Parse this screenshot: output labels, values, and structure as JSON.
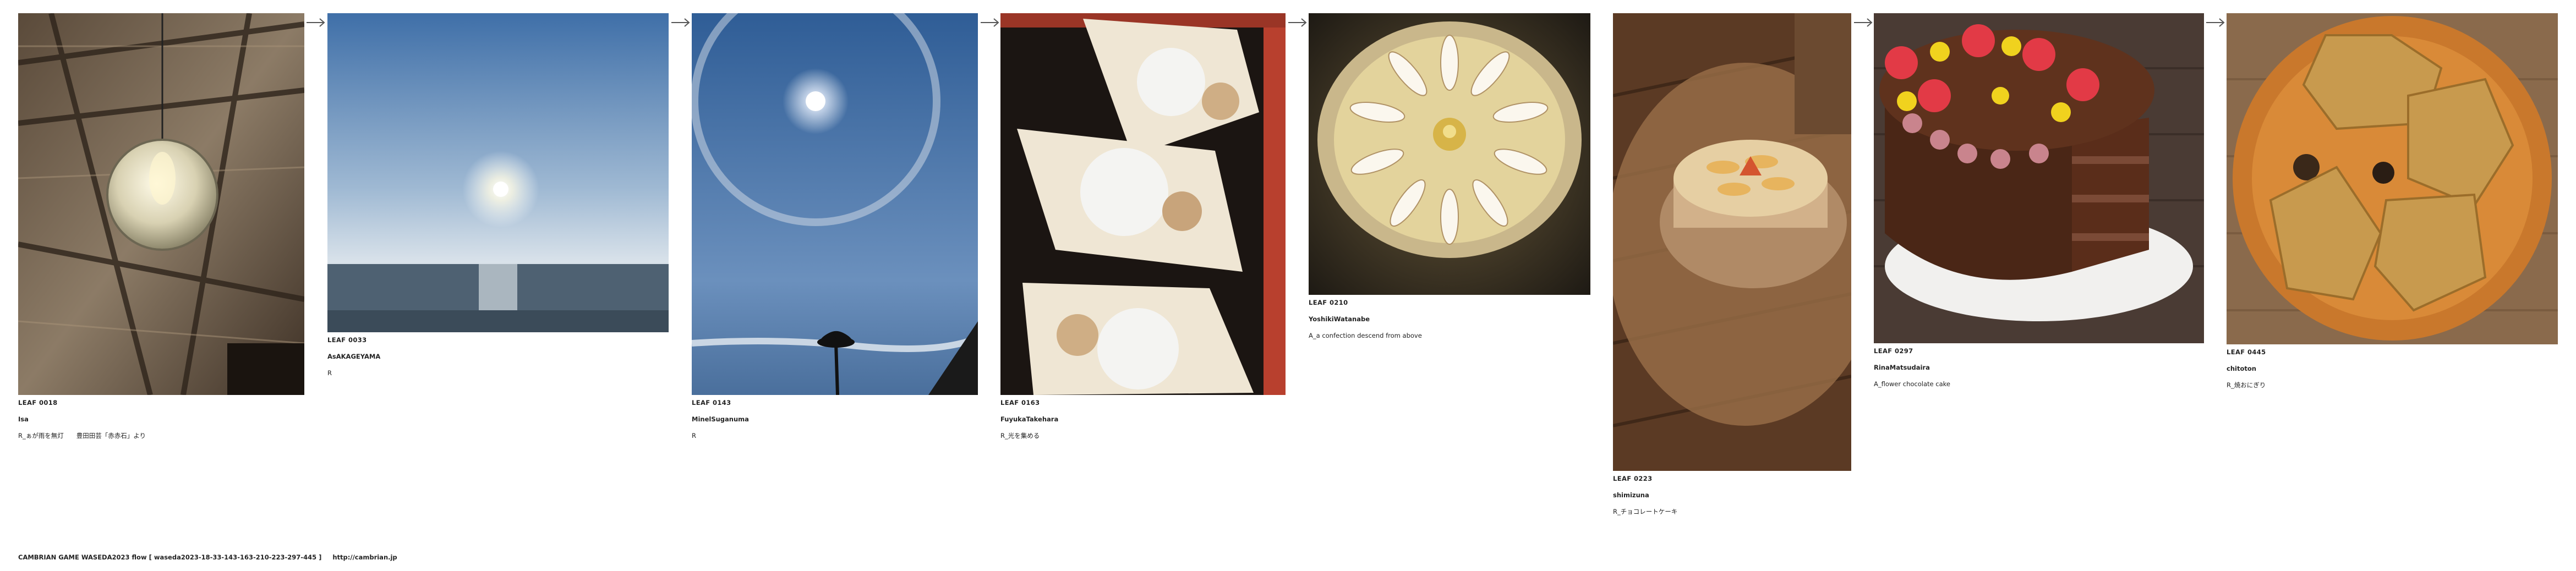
{
  "leaves": [
    {
      "id": "LEAF 0018",
      "author": "Isa",
      "title": "R_ぁが雨を無灯　　豊田田芸「赤赤石」より",
      "image": "attic-lamp"
    },
    {
      "id": "LEAF 0033",
      "author": "AsAKAGEYAMA",
      "title": "R",
      "image": "sea-sunrise"
    },
    {
      "id": "LEAF 0143",
      "author": "MinelSuganuma",
      "title": "R",
      "image": "sun-halo"
    },
    {
      "id": "LEAF 0163",
      "author": "FuyukaTakehara",
      "title": "R_光を集める",
      "image": "white-sweets"
    },
    {
      "id": "LEAF 0210",
      "author": "YoshikiWatanabe",
      "title": "A_a confection descend from above",
      "image": "apple-tart"
    },
    {
      "id": "LEAF 0223",
      "author": "shimizuna",
      "title": "R_チョコレートケーキ",
      "image": "fruit-cake"
    },
    {
      "id": "LEAF 0297",
      "author": "RinaMatsudaira",
      "title": "A_flower chocolate cake",
      "image": "chocolate-cake"
    },
    {
      "id": "LEAF 0445",
      "author": "chitoton",
      "title": "R_焼おにぎり",
      "image": "rice-balls"
    }
  ],
  "footer": {
    "game": "CAMBRIAN GAME  WASEDA2023  flow [ waseda2023-18-33-143-163-210-223-297-445 ]",
    "url": "http://cambrian.jp"
  },
  "colors": {
    "text": "#222222",
    "arrow": "#555555"
  }
}
